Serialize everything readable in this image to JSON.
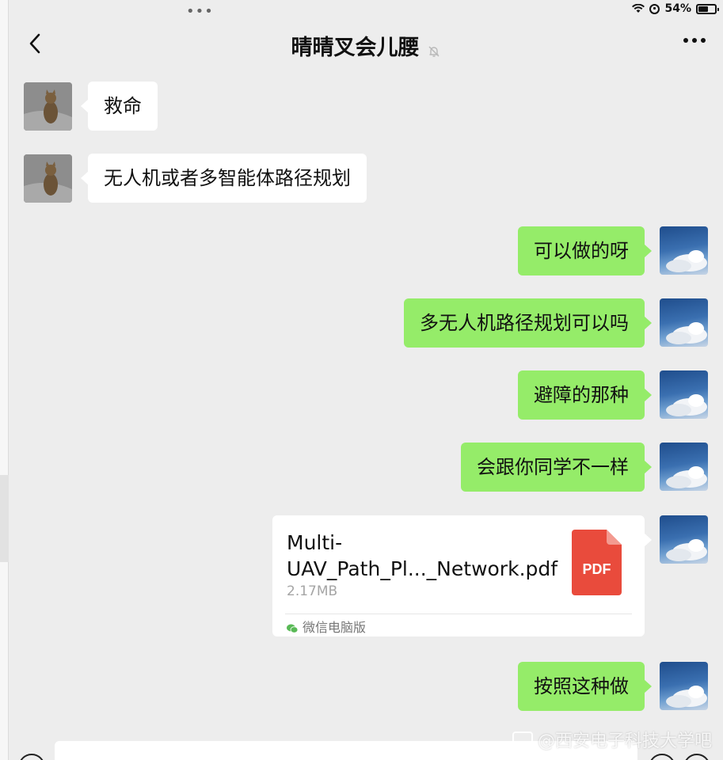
{
  "status": {
    "dots": "•••",
    "battery_text": "54%",
    "battery_level": 0.54
  },
  "nav": {
    "title": "晴晴叉会儿腰"
  },
  "messages": [
    {
      "dir": "in",
      "text": "救命"
    },
    {
      "dir": "in",
      "text": "无人机或者多智能体路径规划"
    },
    {
      "dir": "out",
      "text": "可以做的呀"
    },
    {
      "dir": "out",
      "text": "多无人机路径规划可以吗"
    },
    {
      "dir": "out",
      "text": "避障的那种"
    },
    {
      "dir": "out",
      "text": "会跟你同学不一样"
    },
    {
      "dir": "out",
      "text": "按照这种做"
    }
  ],
  "file": {
    "name": "Multi-UAV_Path_Pl..._Network.pdf",
    "name_line1": "Multi-",
    "name_line2": "UAV_Path_Pl..._Network.pdf",
    "size": "2.17MB",
    "type_label": "PDF",
    "source": "微信电脑版"
  },
  "watermark": "@西安电子科技大学吧",
  "colors": {
    "background": "#ededed",
    "outgoing_bubble": "#95ec69",
    "incoming_bubble": "#ffffff",
    "pdf_red": "#e94b3c"
  },
  "icons": [
    "back-icon",
    "mute-bell-icon",
    "more-icon",
    "wifi-icon",
    "lock-rotation-icon",
    "battery-icon",
    "pdf-icon",
    "wechat-icon"
  ]
}
